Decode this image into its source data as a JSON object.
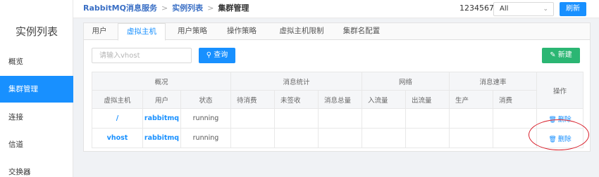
{
  "sidebar": {
    "title": "实例列表",
    "items": [
      {
        "label": "概览",
        "active": false
      },
      {
        "label": "集群管理",
        "active": true
      },
      {
        "label": "连接",
        "active": false
      },
      {
        "label": "信道",
        "active": false
      },
      {
        "label": "交换器",
        "active": false
      }
    ]
  },
  "header": {
    "breadcrumb": {
      "root": "RabbitMQ消息服务",
      "list": "实例列表",
      "current": "集群管理"
    },
    "account_label": "1234567:",
    "select_value": "All",
    "refresh_label": "刷新"
  },
  "tabs": [
    {
      "label": "用户",
      "active": false
    },
    {
      "label": "虚拟主机",
      "active": true
    },
    {
      "label": "用户策略",
      "active": false
    },
    {
      "label": "操作策略",
      "active": false
    },
    {
      "label": "虚拟主机限制",
      "active": false
    },
    {
      "label": "集群名配置",
      "active": false
    }
  ],
  "toolbar": {
    "search_placeholder": "请输入vhost",
    "query_label": "查询",
    "create_label": "新建"
  },
  "table": {
    "group_headers": [
      "概况",
      "消息统计",
      "网络",
      "消息速率",
      "操作"
    ],
    "columns": [
      "虚拟主机",
      "用户",
      "状态",
      "待消费",
      "未签收",
      "消息总量",
      "入流量",
      "出流量",
      "生产",
      "消费"
    ],
    "rows": [
      {
        "vhost": "/",
        "user": "rabbitmq",
        "status": "running",
        "action": "删除"
      },
      {
        "vhost": "vhost",
        "user": "rabbitmq",
        "status": "running",
        "action": "删除"
      }
    ]
  },
  "colors": {
    "primary": "#1890ff",
    "success": "#2bb673",
    "highlight": "#d81e2a"
  },
  "icons": {
    "search": "search-icon",
    "add": "plus-icon",
    "delete": "trash-icon",
    "dropdown": "chevron-down-icon"
  }
}
